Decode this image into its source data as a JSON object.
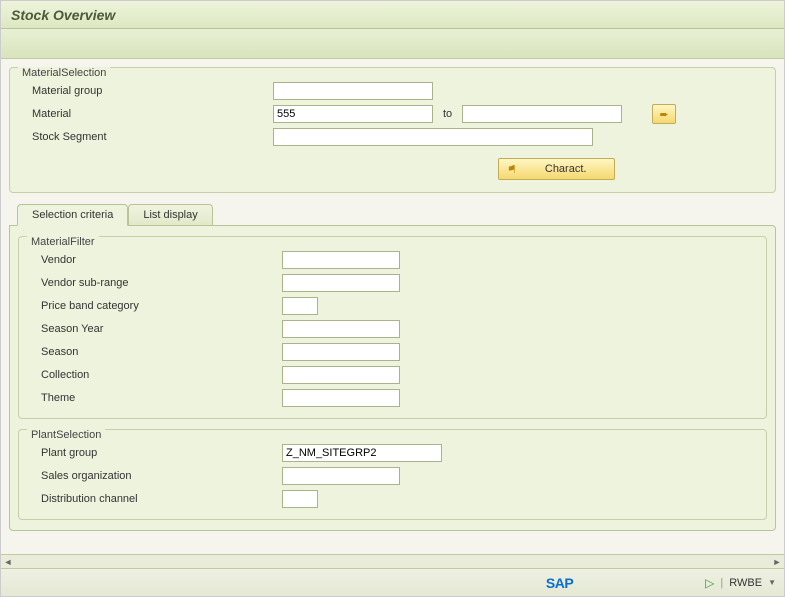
{
  "title": "Stock Overview",
  "material_selection": {
    "legend": "MaterialSelection",
    "material_group_label": "Material group",
    "material_group_value": "",
    "material_label": "Material",
    "material_value": "555",
    "to_label": "to",
    "material_to_value": "",
    "stock_segment_label": "Stock Segment",
    "stock_segment_value": "",
    "charact_label": "Charact."
  },
  "tabs": {
    "t0": "Selection criteria",
    "t1": "List display",
    "active": 0
  },
  "material_filter": {
    "legend": "MaterialFilter",
    "vendor_label": "Vendor",
    "vendor_value": "",
    "vendor_subrange_label": "Vendor sub-range",
    "vendor_subrange_value": "",
    "price_band_label": "Price band category",
    "price_band_value": "",
    "season_year_label": "Season Year",
    "season_year_value": "",
    "season_label": "Season",
    "season_value": "",
    "collection_label": "Collection",
    "collection_value": "",
    "theme_label": "Theme",
    "theme_value": ""
  },
  "plant_selection": {
    "legend": "PlantSelection",
    "plant_group_label": "Plant group",
    "plant_group_value": "Z_NM_SITEGRP2",
    "sales_org_label": "Sales organization",
    "sales_org_value": "",
    "dist_channel_label": "Distribution channel",
    "dist_channel_value": ""
  },
  "status": {
    "tcode": "RWBE",
    "brand": "SAP"
  }
}
